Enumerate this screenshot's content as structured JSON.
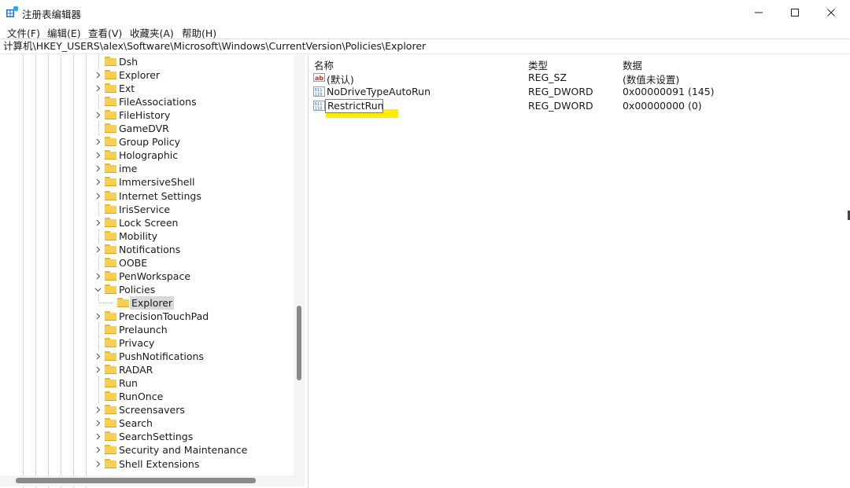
{
  "window": {
    "title": "注册表编辑器",
    "icon": "registry-editor-icon",
    "controls": [
      "minimize-icon",
      "maximize-icon",
      "close-icon"
    ]
  },
  "menu": [
    "文件(F)",
    "编辑(E)",
    "查看(V)",
    "收藏夹(A)",
    "帮助(H)"
  ],
  "address": "计算机\\HKEY_USERS\\alex\\Software\\Microsoft\\Windows\\CurrentVersion\\Policies\\Explorer",
  "tree": {
    "items": [
      {
        "label": "Dsh",
        "expander": "none"
      },
      {
        "label": "Explorer",
        "expander": "collapsed"
      },
      {
        "label": "Ext",
        "expander": "collapsed"
      },
      {
        "label": "FileAssociations",
        "expander": "none"
      },
      {
        "label": "FileHistory",
        "expander": "collapsed"
      },
      {
        "label": "GameDVR",
        "expander": "none"
      },
      {
        "label": "Group Policy",
        "expander": "collapsed"
      },
      {
        "label": "Holographic",
        "expander": "collapsed"
      },
      {
        "label": "ime",
        "expander": "collapsed"
      },
      {
        "label": "ImmersiveShell",
        "expander": "collapsed"
      },
      {
        "label": "Internet Settings",
        "expander": "collapsed"
      },
      {
        "label": "IrisService",
        "expander": "none"
      },
      {
        "label": "Lock Screen",
        "expander": "collapsed"
      },
      {
        "label": "Mobility",
        "expander": "none"
      },
      {
        "label": "Notifications",
        "expander": "collapsed"
      },
      {
        "label": "OOBE",
        "expander": "none"
      },
      {
        "label": "PenWorkspace",
        "expander": "collapsed"
      },
      {
        "label": "Policies",
        "expander": "expanded"
      },
      {
        "label": "Explorer",
        "expander": "none",
        "child": true,
        "selected": true
      },
      {
        "label": "PrecisionTouchPad",
        "expander": "collapsed"
      },
      {
        "label": "Prelaunch",
        "expander": "none"
      },
      {
        "label": "Privacy",
        "expander": "none"
      },
      {
        "label": "PushNotifications",
        "expander": "collapsed"
      },
      {
        "label": "RADAR",
        "expander": "collapsed"
      },
      {
        "label": "Run",
        "expander": "none"
      },
      {
        "label": "RunOnce",
        "expander": "none"
      },
      {
        "label": "Screensavers",
        "expander": "collapsed"
      },
      {
        "label": "Search",
        "expander": "collapsed"
      },
      {
        "label": "SearchSettings",
        "expander": "collapsed"
      },
      {
        "label": "Security and Maintenance",
        "expander": "collapsed"
      },
      {
        "label": "Shell Extensions",
        "expander": "collapsed"
      }
    ]
  },
  "list": {
    "headers": {
      "name": "名称",
      "type": "类型",
      "data": "数据"
    },
    "rows": [
      {
        "name": "(默认)",
        "type": "REG_SZ",
        "data": "(数值未设置)",
        "icon": "string-value-icon"
      },
      {
        "name": "NoDriveTypeAutoRun",
        "type": "REG_DWORD",
        "data": "0x00000091 (145)",
        "icon": "binary-value-icon"
      },
      {
        "name": "RestrictRun",
        "type": "REG_DWORD",
        "data": "0x00000000 (0)",
        "icon": "binary-value-icon",
        "editing": true
      }
    ]
  },
  "colors": {
    "folder": "#f7cf52",
    "highlight": "#ffee00",
    "selection": "#d9d9d9",
    "icon_blue": "#1e73c8"
  }
}
